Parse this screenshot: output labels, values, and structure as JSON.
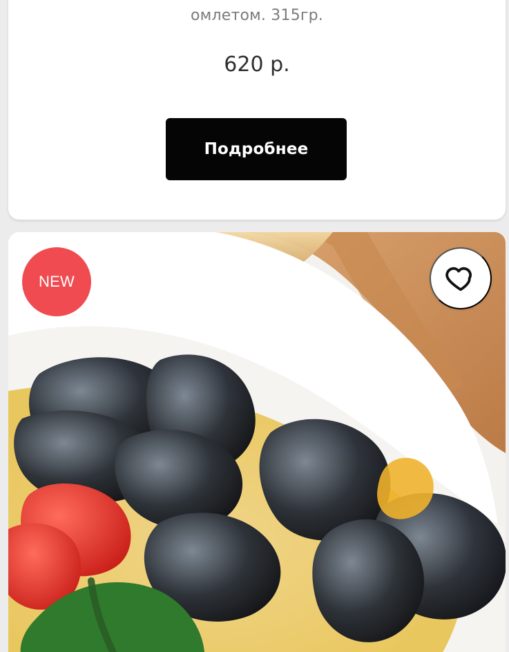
{
  "menu_item_top": {
    "description": "омлетом. 315гр.",
    "price": "620 р.",
    "details_button_label": "Подробнее"
  },
  "menu_item_bottom": {
    "badge_label": "NEW",
    "photo_icon": "mussels-food-photo",
    "favorite_icon": "heart-icon"
  },
  "colors": {
    "badge": "#f04b50",
    "button": "#050505",
    "card": "#ffffff"
  }
}
